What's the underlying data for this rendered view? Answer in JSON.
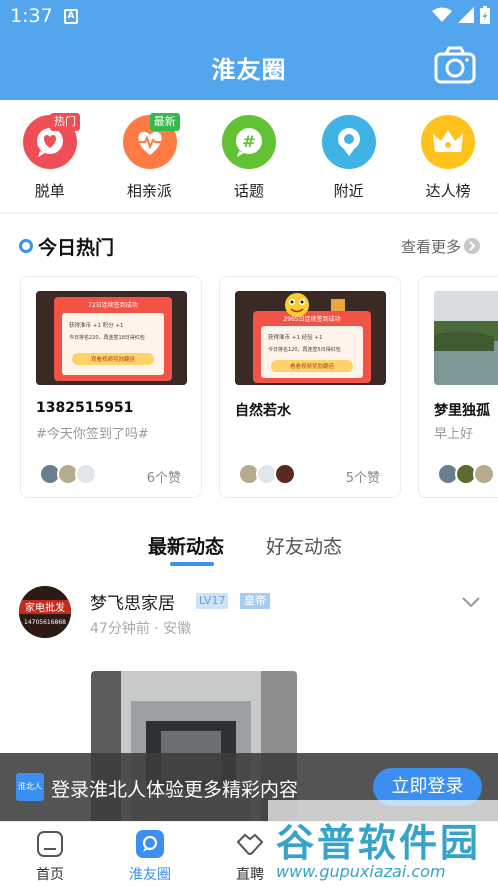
{
  "status_bar": {
    "time": "1:37",
    "sim_label": "A"
  },
  "header": {
    "title": "淮友圈",
    "camera_icon": "camera-icon"
  },
  "categories": [
    {
      "label": "脱单",
      "icon": "heart-chat-icon",
      "color": "#f04e56",
      "badge": "热门",
      "badge_color": "#f04e56"
    },
    {
      "label": "相亲派",
      "icon": "heartbeat-icon",
      "color": "#ff7b45",
      "badge": "最新",
      "badge_color": "#35b84c"
    },
    {
      "label": "话题",
      "icon": "hashtag-icon",
      "color": "#62c234"
    },
    {
      "label": "附近",
      "icon": "location-pin-icon",
      "color": "#3fb3e6"
    },
    {
      "label": "达人榜",
      "icon": "crown-icon",
      "color": "#ffc21c"
    }
  ],
  "hot": {
    "title": "今日热门",
    "more": "查看更多",
    "cards": [
      {
        "name": "1382515951",
        "sub": "#今天你签到了吗#",
        "likes": "6个赞",
        "thumb": {
          "headline": "72日连续签到成功",
          "line1": "获得淮币 +1   积分 +1",
          "line2": "今日排名220，再连签18日得红包",
          "button": "观看视频奖励翻倍"
        }
      },
      {
        "name": "自然若水",
        "sub": "",
        "likes": "5个赞",
        "thumb": {
          "headline": "2965日连续签到成功",
          "line1": "获得淮币 +1   经验 +1",
          "line2": "今日排名120，再连签5日得红包",
          "button": "看看视频奖励翻倍"
        }
      },
      {
        "name": "梦里独孤",
        "sub": "早上好",
        "likes": ""
      }
    ]
  },
  "feed_tabs": {
    "latest": "最新动态",
    "friends": "好友动态"
  },
  "post": {
    "username": "梦飞思家居",
    "level": "LV17",
    "rank": "皇帝",
    "meta": "47分钟前 · 安徽",
    "avatar_text": "家电批发",
    "avatar_phone": "14705616868"
  },
  "login_banner": {
    "logo_text": "淮北人",
    "text": "登录淮北人体验更多精彩内容",
    "button": "立即登录"
  },
  "tabbar": [
    {
      "label": "首页",
      "icon": "home-icon"
    },
    {
      "label": "淮友圈",
      "icon": "chat-bubble-icon",
      "active": true
    },
    {
      "label": "直聘",
      "icon": "handshake-icon"
    }
  ],
  "watermark": {
    "line1": "谷普软件园",
    "line2": "www.gupuxiazai.com"
  }
}
